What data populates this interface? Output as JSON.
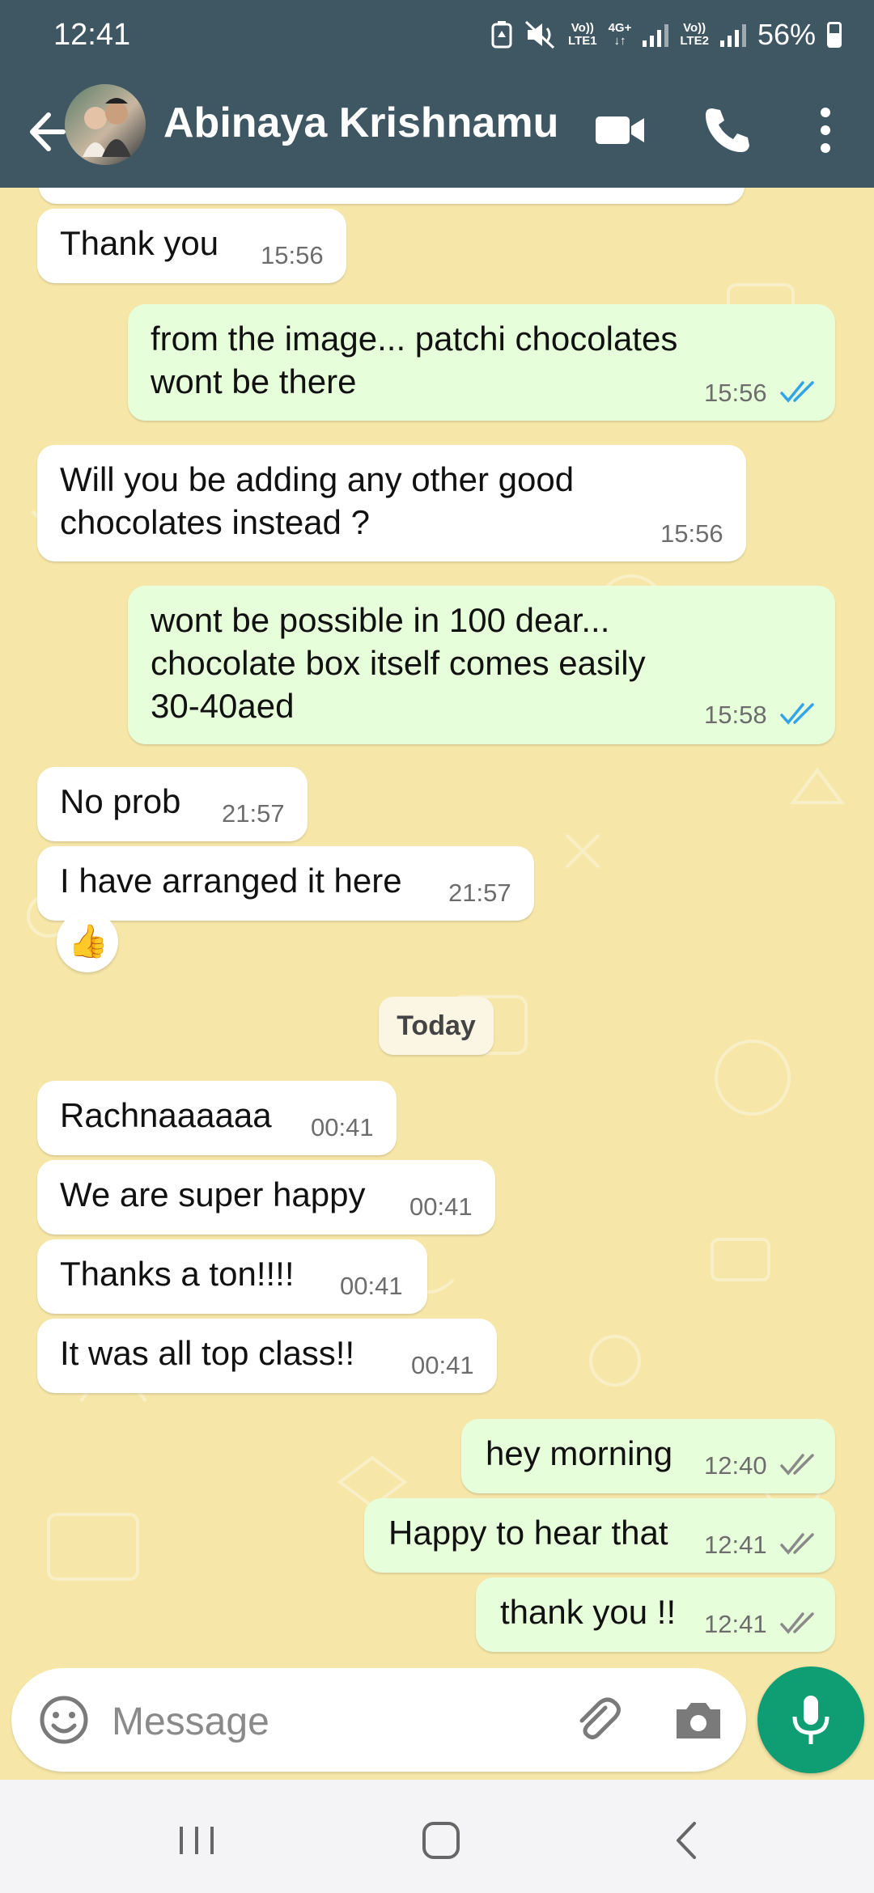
{
  "status_bar": {
    "time": "12:41",
    "sim1_top": "Vo))",
    "sim1_bottom": "LTE1",
    "net_top": "4G+",
    "net_bottom": "↓↑",
    "sim2_top": "Vo))",
    "sim2_bottom": "LTE2",
    "battery": "56%"
  },
  "header": {
    "contact_name": "Abinaya Krishnamu..."
  },
  "messages": [
    {
      "dir": "in",
      "text": "Thank you",
      "time": "15:56"
    },
    {
      "dir": "out",
      "text": "from the image... patchi chocolates\nwont be there",
      "time": "15:56",
      "read": true
    },
    {
      "dir": "in",
      "text": "Will you be adding any other good\nchocolates instead ?",
      "time": "15:56"
    },
    {
      "dir": "out",
      "text": "wont be possible in 100 dear...\nchocolate box itself comes easily\n30-40aed",
      "time": "15:58",
      "read": true
    },
    {
      "dir": "in",
      "text": "No prob",
      "time": "21:57"
    },
    {
      "dir": "in",
      "text": "I have arranged it here",
      "time": "21:57",
      "reaction": "👍"
    },
    {
      "dir": "in",
      "text": "Rachnaaaaaa",
      "time": "00:41"
    },
    {
      "dir": "in",
      "text": "We are super happy",
      "time": "00:41"
    },
    {
      "dir": "in",
      "text": "Thanks a ton!!!!",
      "time": "00:41"
    },
    {
      "dir": "in",
      "text": "It was all top class!!",
      "time": "00:41"
    },
    {
      "dir": "out",
      "text": "hey morning",
      "time": "12:40",
      "read": false
    },
    {
      "dir": "out",
      "text": "Happy to hear that",
      "time": "12:41",
      "read": false
    },
    {
      "dir": "out",
      "text": "thank you !!",
      "time": "12:41",
      "read": false
    }
  ],
  "day_divider": "Today",
  "composer": {
    "placeholder": "Message"
  },
  "colors": {
    "header": "#3f5663",
    "chat_bg": "#f6e7a8",
    "incoming": "#ffffff",
    "outgoing": "#e6ffda",
    "read_tick": "#34a4e8",
    "sent_tick": "#8a8a8a",
    "mic": "#0f9d73"
  }
}
